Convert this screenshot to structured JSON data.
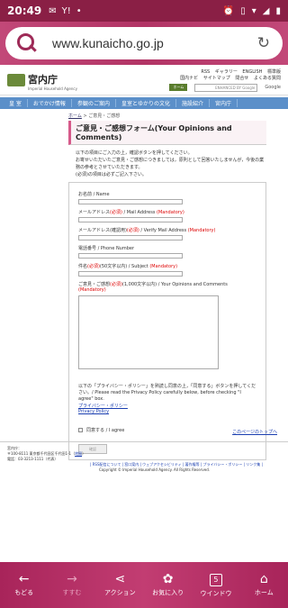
{
  "status_bar": {
    "time": "20:49",
    "icons": [
      "gmail-icon",
      "yahoo-icon",
      "dot-icon"
    ],
    "right_icons": [
      "alarm-icon",
      "vibrate-icon",
      "wifi-icon",
      "signal-icon",
      "battery-icon"
    ]
  },
  "browser": {
    "url": "www.kunaicho.go.jp",
    "search_icon": "search-icon",
    "reload_icon": "reload-icon"
  },
  "site_header": {
    "logo_name": "宮内庁",
    "logo_sub": "Imperial Household Agency",
    "tools": [
      "RSS",
      "ギャラリー",
      "ENGLISH",
      "標準版"
    ],
    "tools2": [
      "国内ナビ",
      "サイトマップ",
      "問合せ",
      "よくある質問"
    ],
    "search_placeholder": "ENHANCED BY Google",
    "search_button": "Google",
    "home_badge": "ホーム"
  },
  "nav": [
    "皇 室",
    "おでかけ情報",
    "参観のご案内",
    "皇室とゆかりの文化",
    "施設紹介",
    "宮内庁"
  ],
  "breadcrumb": {
    "home": "ホーム",
    "current": "ご意見・ご感想"
  },
  "form": {
    "title": "ご意見・ご感想フォーム(Your Opinions and Comments)",
    "intro1": "以下の項目にご入力の上，確認ボタンを押してください。",
    "intro2": "お寄せいただいたご意見・ご感想につきましては，原則として回答いたしませんが，今後の業務の参考とさせていただきます。",
    "intro3": "(必須)の項目は必ずご記入下さい。",
    "name_label": "お名前 / Name",
    "email_label_pre": "メールアドレス",
    "email_req": "(必須)",
    "email_label_en": " / Mail Address ",
    "email_mand": "(Mandatory)",
    "verify_label_pre": "メールアドレス(確認用)",
    "verify_req": "(必須)",
    "verify_label_en": " / Verify Mail Address ",
    "verify_mand": "(Mandatory)",
    "phone_label": "電話番号 / Phone Number",
    "subject_label_pre": "件名",
    "subject_req": "(必須)",
    "subject_label_en": "(50文字以内) / Subject ",
    "subject_mand": "(Mandatory)",
    "comments_label_pre": "ご意見・ご感想",
    "comments_req": "(必須)",
    "comments_label_en": "(1,000文字以内) / Your Opinions and Comments ",
    "comments_mand": "(Mandatory)",
    "privacy_note": "以下の「プライバシー・ポリシー」を熟読し同意の上，「同意する」ボタンを押してください。/ Please read the Privacy Policy carefully below, before checking \"I agree\" box.",
    "privacy_link_jp": "プライバシー・ポリシー",
    "privacy_link_en": "Privacy Policy",
    "agree_label": "同意する / I agree",
    "submit_label": "確認"
  },
  "to_top": "このページのトップへ",
  "footer": {
    "org": "宮内庁：",
    "address": "〒100-8111 東京都千代田区千代田1-1",
    "map": "地図",
    "phone": "電話：03-3213-1111（代表）",
    "links": "| RSS配信について | 窓口案内 | ウェブアクセシビリティ | 著作権等 | プライバシー・ポリシー | リンク集 |",
    "copyright": "Copyright © Imperial Household Agency. All Rights Reserved."
  },
  "bottom_bar": [
    {
      "label": "もどる",
      "icon": "back-arrow-icon"
    },
    {
      "label": "すすむ",
      "icon": "forward-arrow-icon"
    },
    {
      "label": "アクション",
      "icon": "share-icon"
    },
    {
      "label": "お気に入り",
      "icon": "favorites-flower-icon"
    },
    {
      "label": "ウインドウ",
      "icon": "windows-tab-icon",
      "count": "5"
    },
    {
      "label": "ホーム",
      "icon": "home-icon"
    }
  ]
}
